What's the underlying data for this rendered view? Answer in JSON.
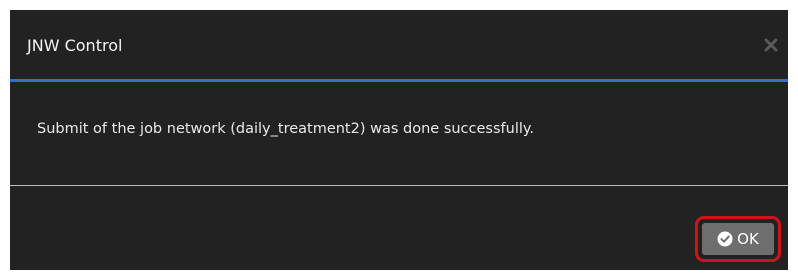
{
  "dialog": {
    "title": "JNW Control",
    "message": "Submit of the job network (daily_treatment2) was done successfully.",
    "ok_label": "OK",
    "close_icon": "close-icon",
    "ok_icon": "check-circle-icon"
  },
  "colors": {
    "dialog_background": "#222222",
    "header_divider": "#2f6fd6",
    "button_background": "#6e6e6e",
    "highlight": "#d0121b"
  }
}
